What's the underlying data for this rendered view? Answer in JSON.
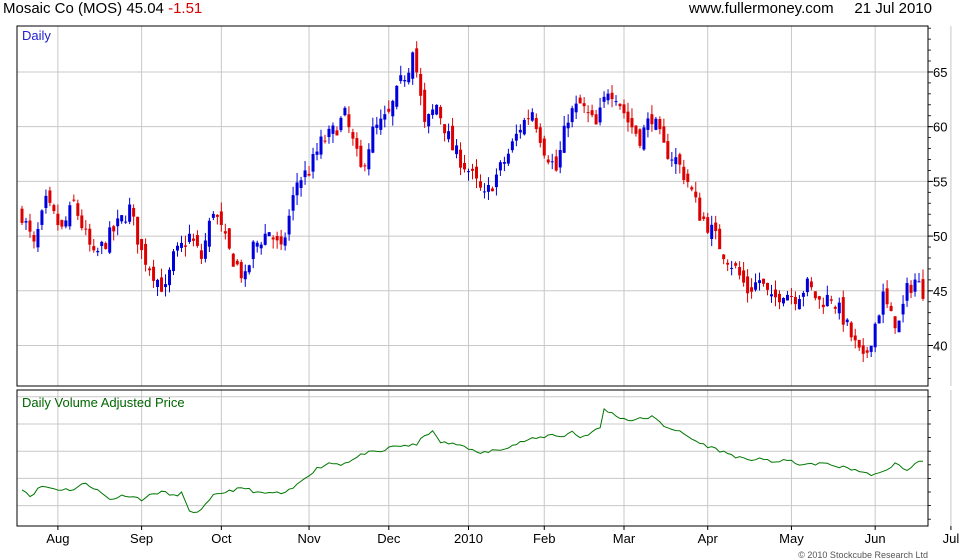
{
  "header": {
    "name": "Mosaic Co (MOS)",
    "last": "45.04",
    "change": "-1.51",
    "site": "www.fullermoney.com",
    "date": "21 Jul 2010"
  },
  "footer": {
    "copyright": "© 2010 Stockcube Research Ltd"
  },
  "colors": {
    "up": "#0000dd",
    "down": "#dd0000",
    "volume_line": "#007700",
    "grid": "#c8c8c8"
  },
  "chart_data": [
    {
      "type": "candlestick",
      "title": "Daily",
      "yticks": [
        40,
        45,
        50,
        55,
        60,
        65
      ],
      "ylim": [
        36.3,
        69.2
      ],
      "grid": true,
      "xticks": [
        "Aug",
        "Sep",
        "Oct",
        "Nov",
        "Dec",
        "2010",
        "Feb",
        "Mar",
        "Apr",
        "May",
        "Jun",
        "Jul"
      ],
      "tick_positions": [
        9,
        30,
        50,
        72,
        92,
        112,
        131,
        151,
        172,
        193,
        214,
        233
      ],
      "close_anchors": [
        [
          0,
          52
        ],
        [
          3,
          49
        ],
        [
          6,
          53
        ],
        [
          10,
          50.5
        ],
        [
          13,
          53
        ],
        [
          18,
          48
        ],
        [
          24,
          51
        ],
        [
          27,
          52.5
        ],
        [
          30,
          48.5
        ],
        [
          34,
          46
        ],
        [
          36,
          45
        ],
        [
          38,
          48
        ],
        [
          42,
          50
        ],
        [
          45,
          48
        ],
        [
          48,
          52.5
        ],
        [
          52,
          48.5
        ],
        [
          56,
          46
        ],
        [
          58,
          49
        ],
        [
          62,
          50.5
        ],
        [
          65,
          48.5
        ],
        [
          69,
          55
        ],
        [
          72,
          56
        ],
        [
          75,
          58.5
        ],
        [
          78,
          59.5
        ],
        [
          81,
          61
        ],
        [
          85,
          56
        ],
        [
          88,
          59.5
        ],
        [
          92,
          61
        ],
        [
          95,
          64
        ],
        [
          97,
          65.5
        ],
        [
          98,
          67.5
        ],
        [
          101,
          60
        ],
        [
          104,
          62
        ],
        [
          108,
          58
        ],
        [
          112,
          56
        ],
        [
          116,
          53.5
        ],
        [
          119,
          55.5
        ],
        [
          122,
          57.5
        ],
        [
          125,
          60
        ],
        [
          128,
          61.5
        ],
        [
          131,
          58
        ],
        [
          134,
          56
        ],
        [
          137,
          61
        ],
        [
          140,
          62
        ],
        [
          144,
          60
        ],
        [
          147,
          63.5
        ],
        [
          149,
          63
        ],
        [
          152,
          60.5
        ],
        [
          155,
          59
        ],
        [
          158,
          61
        ],
        [
          161,
          58
        ],
        [
          164,
          57
        ],
        [
          167,
          55
        ],
        [
          170,
          52
        ],
        [
          173,
          50.5
        ],
        [
          176,
          48.5
        ],
        [
          179,
          47
        ],
        [
          182,
          45
        ],
        [
          185,
          46
        ],
        [
          188,
          44
        ],
        [
          191,
          45
        ],
        [
          194,
          44.5
        ],
        [
          197,
          45.5
        ],
        [
          200,
          44
        ],
        [
          203,
          44.5
        ],
        [
          206,
          42.5
        ],
        [
          209,
          40
        ],
        [
          211,
          38.5
        ],
        [
          212,
          39.5
        ],
        [
          214,
          42
        ],
        [
          216,
          44.5
        ],
        [
          218,
          42.5
        ],
        [
          220,
          42
        ],
        [
          222,
          45
        ],
        [
          224,
          46
        ],
        [
          226,
          45
        ]
      ]
    },
    {
      "type": "line",
      "title": "Daily Volume Adjusted Price",
      "ylim": [
        0,
        1
      ],
      "grid": true,
      "anchors": [
        [
          0,
          0.27
        ],
        [
          2,
          0.2
        ],
        [
          5,
          0.29
        ],
        [
          9,
          0.26
        ],
        [
          13,
          0.26
        ],
        [
          16,
          0.32
        ],
        [
          19,
          0.25
        ],
        [
          22,
          0.17
        ],
        [
          26,
          0.21
        ],
        [
          30,
          0.17
        ],
        [
          33,
          0.22
        ],
        [
          35,
          0.24
        ],
        [
          38,
          0.2
        ],
        [
          40,
          0.23
        ],
        [
          42,
          0.05
        ],
        [
          45,
          0.07
        ],
        [
          48,
          0.2
        ],
        [
          52,
          0.25
        ],
        [
          56,
          0.27
        ],
        [
          60,
          0.22
        ],
        [
          63,
          0.23
        ],
        [
          66,
          0.22
        ],
        [
          69,
          0.3
        ],
        [
          71,
          0.37
        ],
        [
          74,
          0.45
        ],
        [
          77,
          0.5
        ],
        [
          80,
          0.49
        ],
        [
          83,
          0.53
        ],
        [
          86,
          0.59
        ],
        [
          90,
          0.6
        ],
        [
          93,
          0.65
        ],
        [
          96,
          0.66
        ],
        [
          99,
          0.66
        ],
        [
          101,
          0.76
        ],
        [
          103,
          0.78
        ],
        [
          105,
          0.69
        ],
        [
          108,
          0.67
        ],
        [
          111,
          0.66
        ],
        [
          114,
          0.59
        ],
        [
          117,
          0.6
        ],
        [
          120,
          0.63
        ],
        [
          123,
          0.66
        ],
        [
          126,
          0.7
        ],
        [
          130,
          0.73
        ],
        [
          133,
          0.76
        ],
        [
          136,
          0.74
        ],
        [
          138,
          0.79
        ],
        [
          140,
          0.73
        ],
        [
          143,
          0.78
        ],
        [
          145,
          0.82
        ],
        [
          146,
          0.99
        ],
        [
          149,
          0.93
        ],
        [
          152,
          0.89
        ],
        [
          155,
          0.9
        ],
        [
          158,
          0.92
        ],
        [
          161,
          0.84
        ],
        [
          164,
          0.8
        ],
        [
          167,
          0.74
        ],
        [
          170,
          0.68
        ],
        [
          173,
          0.64
        ],
        [
          176,
          0.6
        ],
        [
          179,
          0.56
        ],
        [
          182,
          0.52
        ],
        [
          185,
          0.55
        ],
        [
          188,
          0.5
        ],
        [
          191,
          0.53
        ],
        [
          194,
          0.5
        ],
        [
          197,
          0.48
        ],
        [
          200,
          0.5
        ],
        [
          203,
          0.48
        ],
        [
          206,
          0.46
        ],
        [
          209,
          0.44
        ],
        [
          212,
          0.4
        ],
        [
          215,
          0.4
        ],
        [
          217,
          0.43
        ],
        [
          219,
          0.51
        ],
        [
          221,
          0.44
        ],
        [
          223,
          0.45
        ],
        [
          225,
          0.52
        ],
        [
          226,
          0.52
        ]
      ]
    }
  ]
}
